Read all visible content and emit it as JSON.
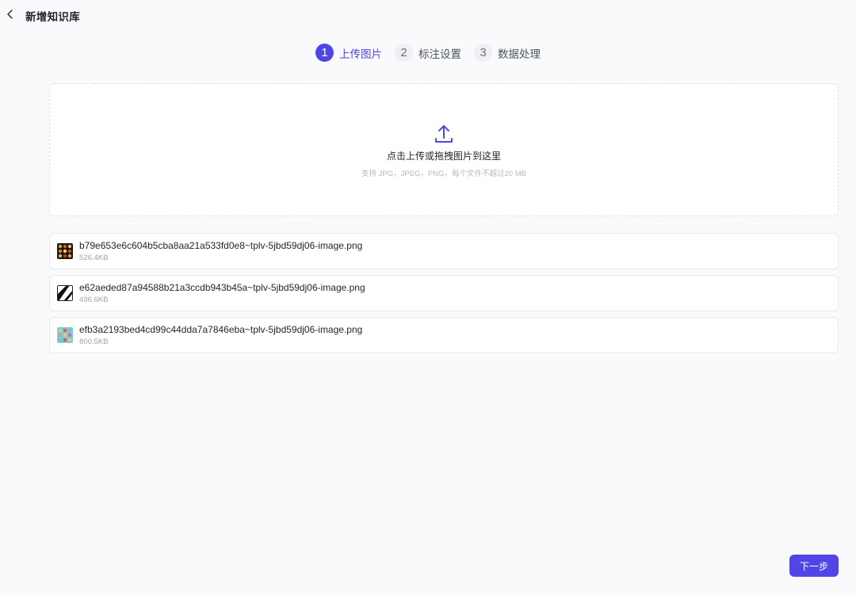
{
  "header": {
    "back_icon": "chevron-left-icon",
    "title": "新增知识库"
  },
  "steps": [
    {
      "number": "1",
      "label": "上传图片",
      "active": true
    },
    {
      "number": "2",
      "label": "标注设置",
      "active": false
    },
    {
      "number": "3",
      "label": "数据处理",
      "active": false
    }
  ],
  "upload": {
    "icon": "upload-icon",
    "title": "点击上传或拖拽图片到这里",
    "hint": "支持 JPG，JPEG，PNG，每个文件不超过20 MB"
  },
  "files": [
    {
      "name": "b79e653e6c604b5cba8aa21a533fd0e8~tplv-5jbd59dj06-image.png",
      "size": "526.4KB",
      "thumb": "food-grid-thumbnail"
    },
    {
      "name": "e62aeded87a94588b21a3ccdb943b45a~tplv-5jbd59dj06-image.png",
      "size": "496.6KB",
      "thumb": "black-white-thumbnail"
    },
    {
      "name": "efb3a2193bed4cd99c44dda7a7846eba~tplv-5jbd59dj06-image.png",
      "size": "800.5KB",
      "thumb": "blue-grid-thumbnail"
    }
  ],
  "footer": {
    "next_label": "下一步"
  },
  "colors": {
    "accent": "#4f46e5",
    "background": "#fafafc"
  }
}
